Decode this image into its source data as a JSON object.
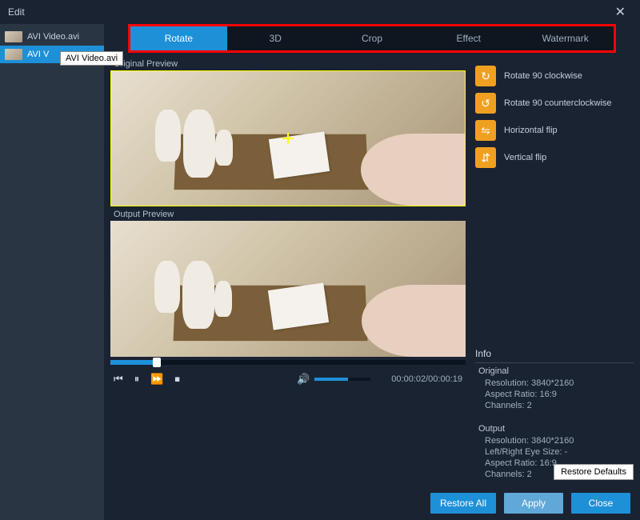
{
  "title": "Edit",
  "sidebar": {
    "items": [
      {
        "label": "AVI Video.avi"
      },
      {
        "label": "AVI V"
      }
    ],
    "tooltip": "AVI Video.avi"
  },
  "tabs": [
    "Rotate",
    "3D",
    "Crop",
    "Effect",
    "Watermark"
  ],
  "preview": {
    "original_label": "Original Preview",
    "output_label": "Output Preview"
  },
  "rotate_options": [
    {
      "label": "Rotate 90 clockwise",
      "icon": "↻"
    },
    {
      "label": "Rotate 90 counterclockwise",
      "icon": "↺"
    },
    {
      "label": "Horizontal flip",
      "icon": "⇋"
    },
    {
      "label": "Vertical flip",
      "icon": "⇵"
    }
  ],
  "info": {
    "header": "Info",
    "original": {
      "title": "Original",
      "resolution": "Resolution: 3840*2160",
      "aspect": "Aspect Ratio: 16:9",
      "channels": "Channels: 2"
    },
    "output": {
      "title": "Output",
      "resolution": "Resolution: 3840*2160",
      "eyesize": "Left/Right Eye Size: -",
      "aspect": "Aspect Ratio: 16:9",
      "channels": "Channels: 2"
    }
  },
  "time": "00:00:02/00:00:19",
  "buttons": {
    "restore_defaults": "Restore Defaults",
    "restore_all": "Restore All",
    "apply": "Apply",
    "close": "Close"
  }
}
